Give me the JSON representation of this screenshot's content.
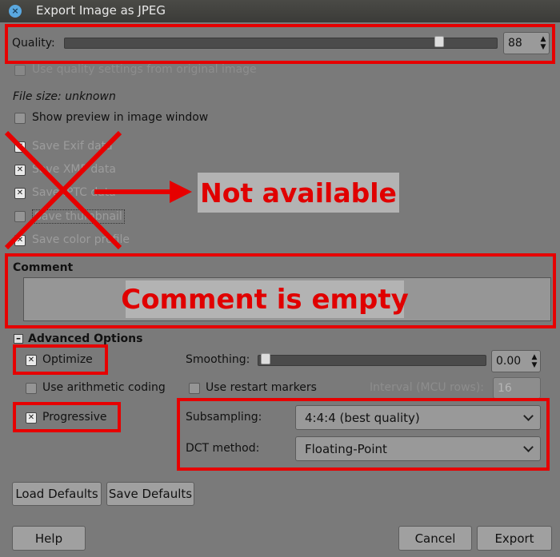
{
  "window": {
    "title": "Export Image as JPEG",
    "close_icon": "close-icon"
  },
  "quality": {
    "label": "Quality:",
    "value": "88",
    "slider_fraction": 0.88
  },
  "options": {
    "use_quality_from_original": "Use quality settings from original image",
    "file_size": "File size: unknown",
    "show_preview": "Show preview in image window",
    "save_exif": "Save Exif data",
    "save_xmp": "Save XMP data",
    "save_iptc": "Save IPTC data",
    "save_thumbnail": "Save thumbnail",
    "save_color_profile": "Save color profile"
  },
  "annotations": {
    "not_available": "Not available",
    "comment_empty": "Comment is empty"
  },
  "comment": {
    "label": "Comment"
  },
  "advanced": {
    "label": "Advanced Options",
    "optimize": "Optimize",
    "smoothing_label": "Smoothing:",
    "smoothing_value": "0.00",
    "smoothing_fraction": 0.0,
    "arithmetic": "Use arithmetic coding",
    "restart": "Use restart markers",
    "interval_label": "Interval (MCU rows):",
    "interval_value": "16",
    "progressive": "Progressive",
    "subsampling_label": "Subsampling:",
    "subsampling_value": "4:4:4 (best quality)",
    "dct_label": "DCT method:",
    "dct_value": "Floating-Point"
  },
  "buttons": {
    "load_defaults": "Load Defaults",
    "save_defaults": "Save Defaults",
    "help": "Help",
    "cancel": "Cancel",
    "export": "Export"
  },
  "colors": {
    "annotation_red": "#e60000",
    "window_bg": "#7a7a7a"
  }
}
